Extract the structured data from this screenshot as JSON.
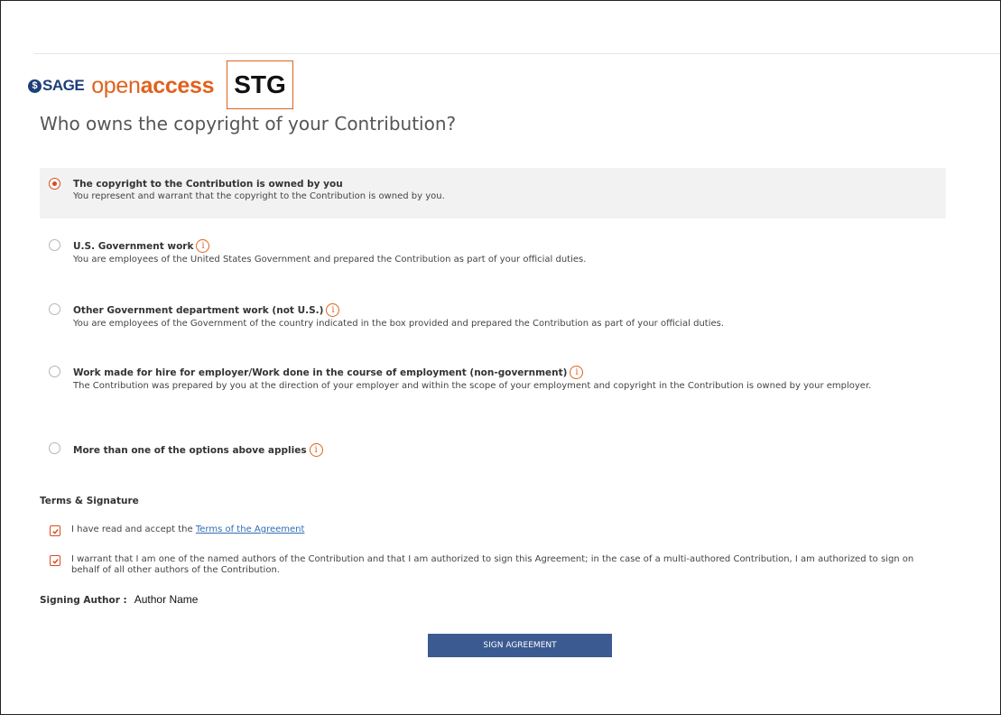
{
  "brand": {
    "sage": "SAGE",
    "sage_mark": "$",
    "open": "open",
    "access": "access",
    "env_badge": "STG",
    "accent_color": "#e0621e",
    "brand_color": "#1d3f7a"
  },
  "question": "Who owns the copyright of your Contribution?",
  "options": [
    {
      "title": "The copyright to the Contribution is owned by you",
      "description": "You represent and warrant that the copyright to the Contribution is owned by you.",
      "selected": true,
      "info": false
    },
    {
      "title": "U.S. Government work",
      "description": "You are employees of the United States Government and prepared the Contribution as part of your official duties.",
      "selected": false,
      "info": true
    },
    {
      "title": "Other Government department work (not U.S.)",
      "description": "You are employees of the Government of the country indicated in the box provided and prepared the Contribution as part of your official duties.",
      "selected": false,
      "info": true
    },
    {
      "title": "Work made for hire for employer/Work done in the course of employment (non-government)",
      "description": "The Contribution was prepared by you at the direction of your employer and within the scope of your employment and copyright in the Contribution is owned by your employer.",
      "selected": false,
      "info": true
    },
    {
      "title": "More than one of the options above applies",
      "description": "",
      "selected": false,
      "info": true
    }
  ],
  "info_icon_glyph": "i",
  "terms": {
    "title": "Terms & Signature",
    "accept_prefix": "I have read and accept the ",
    "accept_link": "Terms of the Agreement",
    "accept_checked": true,
    "warrant_text": "I warrant that I am one of the named authors of the Contribution and that I am authorized to sign this Agreement; in the case of a multi-authored Contribution, I am authorized to sign on behalf of all other authors of the Contribution.",
    "warrant_checked": true
  },
  "signing": {
    "label": "Signing Author :",
    "name": "Author Name"
  },
  "sign_button": "SIGN AGREEMENT"
}
